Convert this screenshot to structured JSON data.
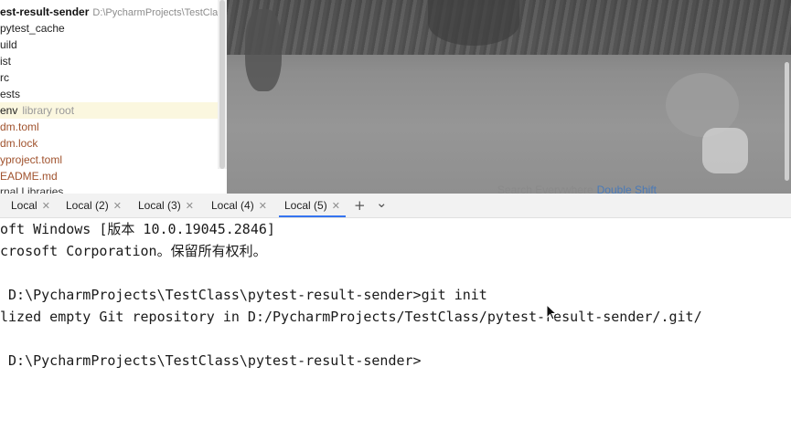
{
  "project_tree": {
    "root_name": "est-result-sender",
    "root_path": "D:\\PycharmProjects\\TestCla",
    "items": [
      {
        "label": "pytest_cache",
        "kind": "folder"
      },
      {
        "label": "uild",
        "kind": "folder"
      },
      {
        "label": "ist",
        "kind": "folder"
      },
      {
        "label": "rc",
        "kind": "folder"
      },
      {
        "label": "ests",
        "kind": "folder"
      },
      {
        "label": "env",
        "kind": "venv",
        "suffix": "library root"
      },
      {
        "label": "dm.toml",
        "kind": "toml"
      },
      {
        "label": "dm.lock",
        "kind": "lock"
      },
      {
        "label": "yproject.toml",
        "kind": "toml"
      },
      {
        "label": "EADME.md",
        "kind": "md"
      },
      {
        "label": "rnal Libraries",
        "kind": "ext"
      }
    ]
  },
  "editor": {
    "search_hint": "Search Everywhere",
    "search_shortcut": "Double Shift"
  },
  "terminal_tabs": {
    "tabs": [
      {
        "label": "Local",
        "active": false
      },
      {
        "label": "Local (2)",
        "active": false
      },
      {
        "label": "Local (3)",
        "active": false
      },
      {
        "label": "Local (4)",
        "active": false
      },
      {
        "label": "Local (5)",
        "active": true
      }
    ],
    "add_label": "+",
    "dropdown_label": "⌄"
  },
  "terminal": {
    "lines": [
      "oft Windows [版本 10.0.19045.2846]",
      "crosoft Corporation。保留所有权利。",
      "",
      " D:\\PycharmProjects\\TestClass\\pytest-result-sender>git init",
      "lized empty Git repository in D:/PycharmProjects/TestClass/pytest-result-sender/.git/",
      "",
      " D:\\PycharmProjects\\TestClass\\pytest-result-sender>"
    ]
  },
  "colors": {
    "accent": "#3574f0",
    "highlight_row": "#fbf7df",
    "file_brown": "#a0522d"
  }
}
